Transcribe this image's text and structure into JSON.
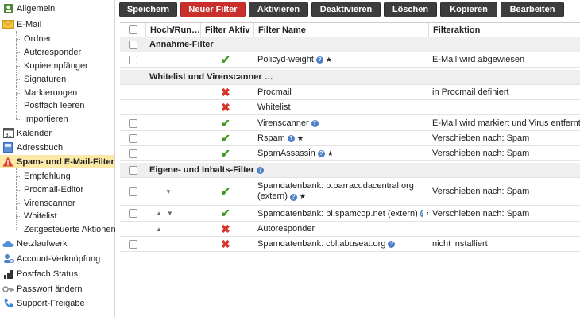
{
  "sidebar": {
    "items": [
      {
        "label": "Allgemein",
        "icon": "person-icon",
        "type": "top"
      },
      {
        "label": "E-Mail",
        "icon": "envelope-icon",
        "type": "top"
      },
      {
        "label": "Ordner",
        "type": "sub"
      },
      {
        "label": "Autoresponder",
        "type": "sub"
      },
      {
        "label": "Kopieempfänger",
        "type": "sub"
      },
      {
        "label": "Signaturen",
        "type": "sub"
      },
      {
        "label": "Markierungen",
        "type": "sub"
      },
      {
        "label": "Postfach leeren",
        "type": "sub"
      },
      {
        "label": "Importieren",
        "type": "sub"
      },
      {
        "label": "Kalender",
        "icon": "calendar-icon",
        "type": "top"
      },
      {
        "label": "Adressbuch",
        "icon": "addressbook-icon",
        "type": "top"
      },
      {
        "label": "Spam- und E-Mail-Filter",
        "icon": "warning-icon",
        "type": "top",
        "active": true
      },
      {
        "label": "Empfehlung",
        "type": "sub"
      },
      {
        "label": "Procmail-Editor",
        "type": "sub"
      },
      {
        "label": "Virenscanner",
        "type": "sub"
      },
      {
        "label": "Whitelist",
        "type": "sub"
      },
      {
        "label": "Zeitgesteuerte Aktionen",
        "type": "sub"
      },
      {
        "label": "Netzlaufwerk",
        "icon": "cloud-icon",
        "type": "top"
      },
      {
        "label": "Account-Verknüpfung",
        "icon": "person-link-icon",
        "type": "top"
      },
      {
        "label": "Postfach Status",
        "icon": "bar-chart-icon",
        "type": "top"
      },
      {
        "label": "Passwort ändern",
        "icon": "key-icon",
        "type": "top"
      },
      {
        "label": "Support-Freigabe",
        "icon": "phone-icon",
        "type": "top"
      }
    ],
    "calendar_day": "31"
  },
  "toolbar": {
    "save": "Speichern",
    "new_filter": "Neuer Filter",
    "activate": "Aktivieren",
    "deactivate": "Deaktivieren",
    "delete": "Löschen",
    "copy": "Kopieren",
    "edit": "Bearbeiten"
  },
  "table": {
    "headers": {
      "move": "Hoch/Run…",
      "active": "Filter Aktiv",
      "name": "Filter Name",
      "action": "Filteraktion"
    },
    "groups": {
      "g1": "Annahme-Filter",
      "g2": "Whitelist und Virenscanner …",
      "g3": "Eigene- und Inhalts-Filter"
    },
    "rows": [
      {
        "name": "Policyd-weight",
        "action": "E-Mail wird abgewiesen",
        "active": true
      },
      {
        "name": "Procmail",
        "action": "in Procmail definiert",
        "active": false
      },
      {
        "name": "Whitelist",
        "action": "",
        "active": false
      },
      {
        "name": "Virenscanner",
        "action": "E-Mail wird markiert und Virus entfernt",
        "active": true
      },
      {
        "name": "Rspam",
        "action": "Verschieben nach: Spam",
        "active": true
      },
      {
        "name": "SpamAssassin",
        "action": "Verschieben nach: Spam",
        "active": true
      },
      {
        "name_line1": "Spamdatenbank: b.barracudacentral.org",
        "name_line2": "(extern)",
        "action": "Verschieben nach: Spam",
        "active": true
      },
      {
        "name": "Spamdatenbank: bl.spamcop.net (extern)",
        "action": "Verschieben nach: Spam",
        "active": true
      },
      {
        "name": "Autoresponder",
        "action": "",
        "active": false
      },
      {
        "name": "Spamdatenbank: cbl.abuseat.org",
        "action": "nicht installiert",
        "active": false
      }
    ]
  },
  "colors": {
    "active_item_bg": "#fce9a8",
    "toolbar_btn": "#3d3d3d",
    "new_filter_btn": "#c9302c",
    "check_green": "#3c9a1f",
    "cross_red": "#d9342b"
  }
}
